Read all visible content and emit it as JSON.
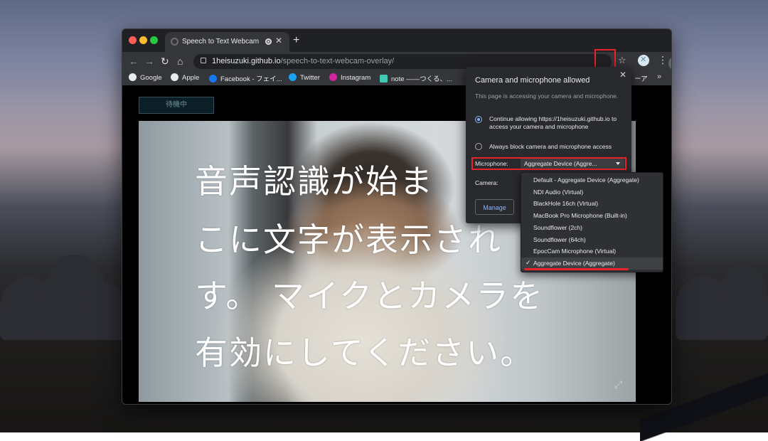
{
  "tab": {
    "title": "Speech to Text Webcam O"
  },
  "omnibox": {
    "host": "1heisuzuki.github.io",
    "path": "/speech-to-text-webcam-overlay/"
  },
  "bookmarks": [
    {
      "label": "Google",
      "icon": "google-icon",
      "color": "#e8eaed"
    },
    {
      "label": "Apple",
      "icon": "apple-icon",
      "color": "#e8eaed"
    },
    {
      "label": "Facebook - フェイ...",
      "icon": "facebook-icon",
      "color": "#1877f2"
    },
    {
      "label": "Twitter",
      "icon": "twitter-icon",
      "color": "#1da1f2"
    },
    {
      "label": "Instagram",
      "icon": "instagram-icon",
      "color": "#d6249f"
    },
    {
      "label": "note ——つくる、...",
      "icon": "note-icon",
      "color": "#41c9b4"
    }
  ],
  "bookmark_overflow_text": "ーア",
  "page": {
    "status_button": "待機中",
    "caption_lines": [
      "音声認識が始ま",
      "こに文字が表示され",
      "す。 マイクとカメラを",
      "有効にしてください。"
    ]
  },
  "popup": {
    "title": "Camera and microphone allowed",
    "description": "This page is accessing your camera and microphone.",
    "option_allow": "Continue allowing https://1heisuzuki.github.io to access your camera and microphone",
    "option_block": "Always block camera and microphone access",
    "microphone_label": "Microphone:",
    "microphone_value": "Aggregate Device (Aggre...",
    "camera_label": "Camera:",
    "manage_label": "Manage"
  },
  "dropdown": {
    "options": [
      "Default - Aggregate Device (Aggregate)",
      "NDI Audio (Virtual)",
      "BlackHole 16ch (Virtual)",
      "MacBook Pro Microphone (Built-in)",
      "Soundflower (2ch)",
      "Soundflower (64ch)",
      "EpocCam Microphone (Virtual)",
      "Aggregate Device (Aggregate)"
    ],
    "selected_index": 7
  },
  "colors": {
    "highlight": "#e8232a",
    "accent": "#8ab4f8"
  }
}
